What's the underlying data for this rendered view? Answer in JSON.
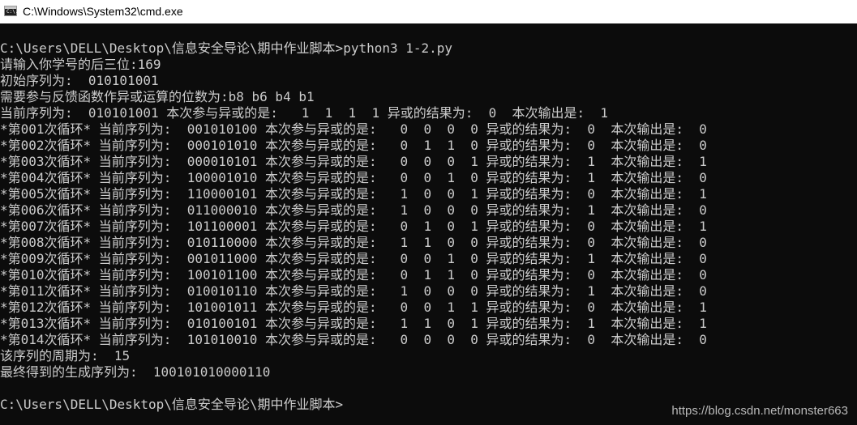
{
  "window": {
    "title": "C:\\Windows\\System32\\cmd.exe",
    "icon": "console-icon",
    "icon_text": "C:\\."
  },
  "console": {
    "lines": [
      "C:\\Users\\DELL\\Desktop\\信息安全导论\\期中作业脚本>python3 1-2.py",
      "请输入你学号的后三位:169",
      "初始序列为:  010101001",
      "需要参与反馈函数作异或运算的位数为:b8 b6 b4 b1",
      "当前序列为:  010101001 本次参与异或的是:   1  1  1  1 异或的结果为:  0  本次输出是:  1",
      "*第001次循环* 当前序列为:  001010100 本次参与异或的是:   0  0  0  0 异或的结果为:  0  本次输出是:  0",
      "*第002次循环* 当前序列为:  000101010 本次参与异或的是:   0  1  1  0 异或的结果为:  0  本次输出是:  0",
      "*第003次循环* 当前序列为:  000010101 本次参与异或的是:   0  0  0  1 异或的结果为:  1  本次输出是:  1",
      "*第004次循环* 当前序列为:  100001010 本次参与异或的是:   0  0  1  0 异或的结果为:  1  本次输出是:  0",
      "*第005次循环* 当前序列为:  110000101 本次参与异或的是:   1  0  0  1 异或的结果为:  0  本次输出是:  1",
      "*第006次循环* 当前序列为:  011000010 本次参与异或的是:   1  0  0  0 异或的结果为:  1  本次输出是:  0",
      "*第007次循环* 当前序列为:  101100001 本次参与异或的是:   0  1  0  1 异或的结果为:  0  本次输出是:  1",
      "*第008次循环* 当前序列为:  010110000 本次参与异或的是:   1  1  0  0 异或的结果为:  0  本次输出是:  0",
      "*第009次循环* 当前序列为:  001011000 本次参与异或的是:   0  0  1  0 异或的结果为:  1  本次输出是:  0",
      "*第010次循环* 当前序列为:  100101100 本次参与异或的是:   0  1  1  0 异或的结果为:  0  本次输出是:  0",
      "*第011次循环* 当前序列为:  010010110 本次参与异或的是:   1  0  0  0 异或的结果为:  1  本次输出是:  0",
      "*第012次循环* 当前序列为:  101001011 本次参与异或的是:   0  0  1  1 异或的结果为:  0  本次输出是:  1",
      "*第013次循环* 当前序列为:  010100101 本次参与异或的是:   1  1  0  1 异或的结果为:  1  本次输出是:  1",
      "*第014次循环* 当前序列为:  101010010 本次参与异或的是:   0  0  0  0 异或的结果为:  0  本次输出是:  0",
      "该序列的周期为:  15",
      "最终得到的生成序列为:  100101010000110",
      "",
      "C:\\Users\\DELL\\Desktop\\信息安全导论\\期中作业脚本>"
    ]
  },
  "watermark": "https://blog.csdn.net/monster663",
  "colors": {
    "console_background": "#0c0c0c",
    "console_text": "#cccccc",
    "titlebar_background": "#ffffff"
  }
}
